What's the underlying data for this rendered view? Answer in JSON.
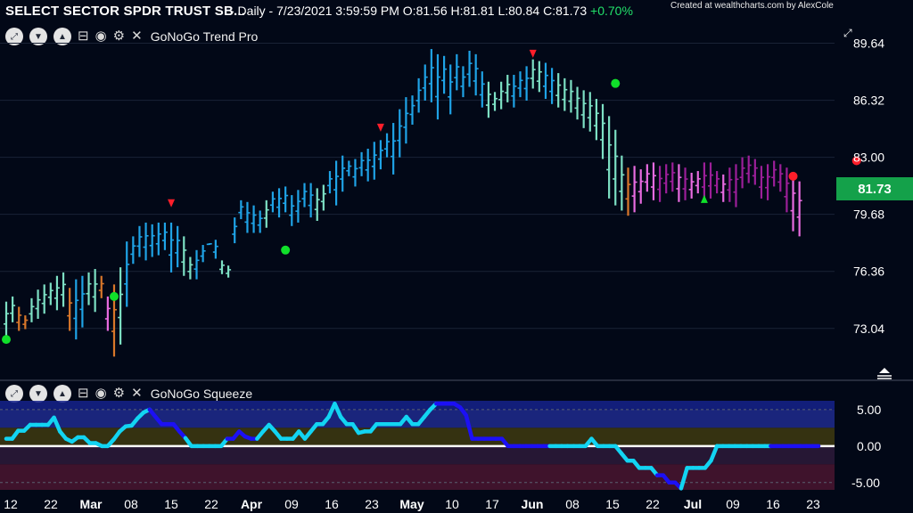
{
  "header": {
    "title": "SELECT SECTOR SPDR TRUST SB...",
    "interval": "- Daily",
    "timestamp": "7/23/2021 3:59:59 PM",
    "open_label": "O:",
    "open": "81.56",
    "high_label": "H:",
    "high": "81.81",
    "low_label": "L:",
    "low": "80.84",
    "close_label": "C:",
    "close": "81.73",
    "change": "+0.70%",
    "credit": "Created at wealthcharts.com by AlexCole"
  },
  "panels": {
    "top": {
      "label": "GoNoGo Trend Pro"
    },
    "bottom": {
      "label": "GoNoGo Squeeze"
    }
  },
  "toolbar_icons": [
    "expand-icon",
    "chevron-down-icon",
    "chevron-up-icon",
    "collapse-icon",
    "eye-icon",
    "gear-icon",
    "close-icon"
  ],
  "price_badge": "81.73",
  "colors": {
    "background": "#020817",
    "go_strong": "#1fa3e6",
    "go_weak": "#7de0c4",
    "amber": "#d9772a",
    "nogo_weak": "#e86be0",
    "nogo_strong": "#9c1f99",
    "badge": "#14a14a",
    "squeeze_line": "#12d4f2",
    "squeeze_max": "#1c10f5",
    "zero_line": "#ffffff"
  },
  "chart_data": [
    {
      "type": "ohlc",
      "title": "GoNoGo Trend Pro",
      "ylim": [
        70.8,
        90.6
      ],
      "y_ticks": [
        "89.64",
        "86.32",
        "83.00",
        "79.68",
        "76.36",
        "73.04"
      ],
      "x_ticks": [
        {
          "label": "12",
          "month": false
        },
        {
          "label": "22",
          "month": false
        },
        {
          "label": "Mar",
          "month": true
        },
        {
          "label": "08",
          "month": false
        },
        {
          "label": "15",
          "month": false
        },
        {
          "label": "22",
          "month": false
        },
        {
          "label": "Apr",
          "month": true
        },
        {
          "label": "09",
          "month": false
        },
        {
          "label": "16",
          "month": false
        },
        {
          "label": "23",
          "month": false
        },
        {
          "label": "May",
          "month": true
        },
        {
          "label": "10",
          "month": false
        },
        {
          "label": "17",
          "month": false
        },
        {
          "label": "Jun",
          "month": true
        },
        {
          "label": "08",
          "month": false
        },
        {
          "label": "15",
          "month": false
        },
        {
          "label": "22",
          "month": false
        },
        {
          "label": "Jul",
          "month": true
        },
        {
          "label": "09",
          "month": false
        },
        {
          "label": "16",
          "month": false
        },
        {
          "label": "23",
          "month": false
        }
      ],
      "series": [
        {
          "colors": [
            "c",
            "c",
            "a",
            "a",
            "c",
            "c",
            "c",
            "c",
            "c",
            "c",
            "a",
            "b",
            "b",
            "c",
            "c",
            "a",
            "m",
            "a",
            "c",
            "b",
            "b",
            "b",
            "b",
            "b",
            "b",
            "b",
            "b",
            "b",
            "c",
            "c",
            "b",
            "b",
            "b",
            "b",
            "c",
            "c",
            "b",
            "b",
            "b",
            "b",
            "b",
            "c",
            "b",
            "b",
            "b",
            "b",
            "b",
            "b",
            "b",
            "c",
            "c",
            "b",
            "b",
            "b",
            "b",
            "b",
            "b",
            "b",
            "b",
            "b",
            "b",
            "b",
            "b",
            "b",
            "b",
            "b",
            "b",
            "b",
            "b",
            "b",
            "b",
            "b",
            "b",
            "b",
            "b",
            "b",
            "c",
            "c",
            "c",
            "c",
            "b",
            "b",
            "b",
            "c",
            "c",
            "b",
            "b",
            "c",
            "c",
            "c",
            "c",
            "c",
            "c",
            "c",
            "c",
            "c",
            "c",
            "c",
            "a",
            "m",
            "m",
            "m",
            "m",
            "p",
            "p",
            "p",
            "m",
            "p",
            "m",
            "m",
            "p",
            "p",
            "p",
            "m",
            "p",
            "p",
            "p",
            "p",
            "p",
            "p",
            "p",
            "p",
            "p",
            "p",
            "m",
            "m"
          ],
          "highs": [
            74.6,
            74.9,
            74.3,
            73.8,
            74.8,
            75.3,
            75.6,
            75.7,
            76.1,
            76.3,
            75.4,
            75.9,
            76.1,
            76.3,
            76.5,
            76.1,
            74.9,
            75.6,
            76.6,
            78.1,
            78.4,
            79.0,
            79.2,
            79.1,
            79.2,
            79.2,
            79.2,
            79.0,
            78.4,
            77.2,
            77.6,
            77.9,
            78.0,
            78.2,
            77.0,
            76.7,
            79.5,
            80.5,
            80.4,
            80.2,
            79.9,
            80.5,
            81.0,
            81.2,
            81.3,
            80.8,
            81.1,
            81.5,
            81.5,
            81.2,
            81.4,
            82.2,
            82.8,
            83.1,
            82.8,
            82.9,
            83.3,
            83.5,
            83.9,
            84.0,
            84.4,
            85.0,
            85.8,
            86.5,
            86.6,
            87.6,
            88.4,
            89.3,
            89.0,
            88.9,
            88.4,
            89.0,
            88.3,
            89.2,
            89.0,
            88.0,
            87.4,
            86.8,
            87.4,
            87.8,
            87.8,
            88.0,
            88.3,
            88.7,
            88.6,
            88.5,
            88.2,
            87.9,
            87.6,
            87.5,
            87.1,
            86.9,
            86.8,
            86.4,
            86.1,
            85.4,
            84.6,
            83.1,
            82.4,
            82.5,
            82.3,
            82.6,
            82.7,
            82.5,
            82.6,
            82.7,
            82.6,
            82.4,
            82.1,
            82.2,
            82.7,
            82.7,
            82.2,
            82.0,
            82.4,
            82.6,
            83.0,
            83.1,
            82.9,
            82.5,
            82.6,
            82.8,
            82.6,
            82.4,
            82.1,
            81.6,
            81.6,
            81.9,
            82.1
          ],
          "lows": [
            72.6,
            73.4,
            72.9,
            73.0,
            73.4,
            73.6,
            73.9,
            74.4,
            74.1,
            74.3,
            72.9,
            72.4,
            73.1,
            74.4,
            74.0,
            74.8,
            72.9,
            71.4,
            72.1,
            74.3,
            76.8,
            77.2,
            77.0,
            77.2,
            77.3,
            77.6,
            76.3,
            76.6,
            76.1,
            75.9,
            75.9,
            76.9,
            77.9,
            77.1,
            76.2,
            76.0,
            78.0,
            79.4,
            78.6,
            78.6,
            78.6,
            78.9,
            79.8,
            79.5,
            79.8,
            79.0,
            79.2,
            80.1,
            79.5,
            79.3,
            79.9,
            80.9,
            80.2,
            81.0,
            81.9,
            81.3,
            81.9,
            81.6,
            81.7,
            82.3,
            83.0,
            82.0,
            83.0,
            83.8,
            84.9,
            85.6,
            86.3,
            86.2,
            85.2,
            86.7,
            85.5,
            86.9,
            86.5,
            87.1,
            86.6,
            85.9,
            85.3,
            85.7,
            85.8,
            86.2,
            85.9,
            86.5,
            86.3,
            87.0,
            86.8,
            86.4,
            86.1,
            85.9,
            85.7,
            85.6,
            85.2,
            84.7,
            84.5,
            84.0,
            82.9,
            80.6,
            80.2,
            79.9,
            79.6,
            79.8,
            80.3,
            81.0,
            80.5,
            80.4,
            80.9,
            81.0,
            80.4,
            80.5,
            80.6,
            80.9,
            80.5,
            80.6,
            80.9,
            80.4,
            80.4,
            80.1,
            81.2,
            81.5,
            81.4,
            80.6,
            80.5,
            81.3,
            81.0,
            79.8,
            78.7,
            78.4,
            79.0,
            80.1,
            80.4
          ]
        }
      ],
      "annotations": [
        {
          "type": "go-dot",
          "bar": 0,
          "price": 72.4
        },
        {
          "type": "go-dot",
          "bar": 17,
          "price": 74.9
        },
        {
          "type": "go-dot",
          "bar": 44,
          "price": 77.6
        },
        {
          "type": "nogo-tri",
          "bar": 26,
          "price": 80.3
        },
        {
          "type": "nogo-tri",
          "bar": 59,
          "price": 84.7
        },
        {
          "type": "nogo-tri",
          "bar": 83,
          "price": 89.0
        },
        {
          "type": "go-dot",
          "bar": 96,
          "price": 87.3
        },
        {
          "type": "go-tri",
          "bar": 110,
          "price": 80.6
        },
        {
          "type": "nogo-dot",
          "bar": 124,
          "price": 81.9
        },
        {
          "type": "nogo-dot",
          "bar": 134,
          "price": 82.8
        }
      ]
    },
    {
      "type": "line",
      "title": "GoNoGo Squeeze",
      "ylim": [
        -6.0,
        6.2
      ],
      "y_ticks": [
        "5.00",
        "0.00",
        "-5.00"
      ],
      "grid": true,
      "series": [
        {
          "name": "",
          "values": [
            1.0,
            1.0,
            2.1,
            2.1,
            2.9,
            2.9,
            2.9,
            2.9,
            3.9,
            2.0,
            1.0,
            0.6,
            1.2,
            1.2,
            0.4,
            0.4,
            0.0,
            0.0,
            0.9,
            2.0,
            2.7,
            2.8,
            3.8,
            4.6,
            5.0,
            4.0,
            3.0,
            3.0,
            3.0,
            2.0,
            1.1,
            0.0,
            0.0,
            0.0,
            0.0,
            0.0,
            0.0,
            1.0,
            1.0,
            2.0,
            1.3,
            1.0,
            1.0,
            2.0,
            2.9,
            2.0,
            1.0,
            1.0,
            1.0,
            2.0,
            1.0,
            2.0,
            3.0,
            3.0,
            4.0,
            5.8,
            4.0,
            3.0,
            3.0,
            1.8,
            2.0,
            2.0,
            3.0,
            3.0,
            3.0,
            3.0,
            3.0,
            4.0,
            3.0,
            3.0,
            4.0,
            5.0,
            5.8,
            5.8,
            5.8,
            5.8,
            5.3,
            4.2,
            1.0,
            1.0,
            1.0,
            1.0,
            1.0,
            1.0,
            0.0,
            0.0,
            0.0,
            0.0,
            0.0,
            0.0,
            0.0,
            0.0,
            0.0,
            0.0,
            0.0,
            0.0,
            0.0,
            0.0,
            1.0,
            0.0,
            0.0,
            0.0,
            0.0,
            -1.0,
            -2.0,
            -2.0,
            -3.0,
            -3.0,
            -3.0,
            -4.0,
            -4.0,
            -5.0,
            -5.0,
            -5.8,
            -3.0,
            -3.0,
            -3.0,
            -3.0,
            -2.0,
            0.0,
            0.0,
            0.0,
            0.0,
            0.0,
            0.0,
            0.0,
            0.0,
            0.0,
            0.0,
            0.0,
            0.0,
            0.0,
            0.0,
            0.0,
            0.0,
            0.0,
            0.0
          ],
          "max_flags": [
            0,
            0,
            0,
            0,
            0,
            0,
            0,
            0,
            0,
            0,
            0,
            0,
            0,
            0,
            0,
            0,
            0,
            0,
            0,
            0,
            0,
            0,
            0,
            0,
            1,
            1,
            1,
            1,
            1,
            1,
            1,
            0,
            0,
            0,
            0,
            0,
            0,
            1,
            1,
            1,
            1,
            1,
            1,
            0,
            0,
            0,
            0,
            0,
            0,
            0,
            0,
            0,
            0,
            0,
            0,
            0,
            0,
            0,
            0,
            0,
            0,
            0,
            0,
            0,
            0,
            0,
            0,
            0,
            0,
            0,
            0,
            0,
            1,
            1,
            1,
            1,
            1,
            1,
            1,
            1,
            1,
            1,
            1,
            1,
            1,
            1,
            1,
            1,
            1,
            1,
            1,
            1,
            0,
            0,
            0,
            0,
            0,
            0,
            0,
            0,
            0,
            0,
            0,
            0,
            0,
            0,
            0,
            0,
            0,
            1,
            1,
            1,
            1,
            1,
            0,
            0,
            0,
            0,
            0,
            0,
            0,
            0,
            0,
            0,
            0,
            0,
            0,
            0,
            1,
            1,
            1,
            1,
            1,
            1,
            1,
            1,
            1,
            1,
            1
          ]
        }
      ]
    }
  ]
}
